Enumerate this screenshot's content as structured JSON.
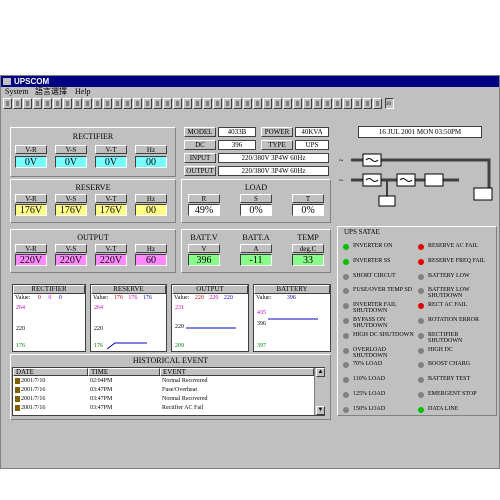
{
  "app": {
    "title": "UPSCOM"
  },
  "menu": [
    {
      "label": "System"
    },
    {
      "label": "語言選擇"
    },
    {
      "label": "Help"
    }
  ],
  "toolbar": {
    "count": 38,
    "selected_label": "30"
  },
  "rectifier": {
    "title": "RECTIFIER",
    "cols": [
      {
        "label": "V-R",
        "value": "0V"
      },
      {
        "label": "V-S",
        "value": "0V"
      },
      {
        "label": "V-T",
        "value": "0V"
      },
      {
        "label": "Hz",
        "value": "00"
      }
    ]
  },
  "reserve": {
    "title": "RESERVE",
    "cols": [
      {
        "label": "V-R",
        "value": "176V"
      },
      {
        "label": "V-S",
        "value": "176V"
      },
      {
        "label": "V-T",
        "value": "176V"
      },
      {
        "label": "Hz",
        "value": "00"
      }
    ]
  },
  "output": {
    "title": "OUTPUT",
    "cols": [
      {
        "label": "V-R",
        "value": "220V"
      },
      {
        "label": "V-S",
        "value": "220V"
      },
      {
        "label": "V-T",
        "value": "220V"
      },
      {
        "label": "Hz",
        "value": "60"
      }
    ]
  },
  "info": {
    "model_label": "MODEL",
    "model_value": "4033B",
    "power_label": "POWER",
    "power_value": "40KVA",
    "dc_label": "DC",
    "dc_value": "396",
    "type_label": "TYPE",
    "type_value": "UPS",
    "input_label": "INPUT",
    "input_value": "220/380V 3P4W 60Hz",
    "output_label": "OUTPUT",
    "output_value": "220/380V 3P4W 60Hz"
  },
  "load": {
    "title": "LOAD",
    "cols": [
      {
        "label": "R",
        "value": "49%"
      },
      {
        "label": "S",
        "value": "0%"
      },
      {
        "label": "T",
        "value": "0%"
      }
    ]
  },
  "battery_stats": {
    "cols": [
      {
        "title": "BATT.V",
        "label": "V",
        "value": "396"
      },
      {
        "title": "BATT.A",
        "label": "A",
        "value": "-11"
      },
      {
        "title": "TEMP",
        "label": "deg.C",
        "value": "33"
      }
    ]
  },
  "clock": {
    "text": "16 JUL 2001 MON  03:50PM"
  },
  "charts": [
    {
      "title": "RECTIFIER",
      "values_label": "Value:",
      "v1": "0",
      "v2": "0",
      "v3": "0",
      "labels": [
        "264",
        "220",
        "176"
      ]
    },
    {
      "title": "RESERVE",
      "values_label": "Value:",
      "v1": "176",
      "v2": "176",
      "v3": "176",
      "labels": [
        "264",
        "220",
        "176"
      ]
    },
    {
      "title": "OUTPUT",
      "values_label": "Value:",
      "v1": "220",
      "v2": "220",
      "v3": "220",
      "labels": [
        "231",
        "220",
        "209"
      ]
    },
    {
      "title": "BATTERY",
      "values_label": "Value:",
      "v1": "396",
      "v2": "",
      "v3": "",
      "labels": [
        "435",
        "396",
        "397"
      ]
    }
  ],
  "status": {
    "title": "UPS SATAE",
    "left": [
      {
        "label": "INVERTER ON",
        "color": "#00c000"
      },
      {
        "label": "INVERTER SS",
        "color": "#00c000"
      },
      {
        "label": "SHORT CIRCUT",
        "color": "#808080"
      },
      {
        "label": "FUSE/OVER TEMP SD",
        "color": "#808080"
      },
      {
        "label": "INVERTER FAIL SHUTDOWN",
        "color": "#808080"
      },
      {
        "label": "BYPASS ON SHUTDOWN",
        "color": "#808080"
      },
      {
        "label": "HIGH DC SHUTDOWN",
        "color": "#808080"
      },
      {
        "label": "OVERLOAD SHUTDOWN",
        "color": "#808080"
      },
      {
        "label": "70% LOAD",
        "color": "#808080"
      },
      {
        "label": "110% LOAD",
        "color": "#808080"
      },
      {
        "label": "125% LOAD",
        "color": "#808080"
      },
      {
        "label": "150% LOAD",
        "color": "#808080"
      }
    ],
    "right": [
      {
        "label": "RESERVE AC FAIL",
        "color": "#e00000"
      },
      {
        "label": "RESERVE FREQ FAIL",
        "color": "#e00000"
      },
      {
        "label": "BATTERY LOW",
        "color": "#808080"
      },
      {
        "label": "BATTERY LOW SHUTDOWN",
        "color": "#808080"
      },
      {
        "label": "RECT AC FAIL",
        "color": "#e00000"
      },
      {
        "label": "ROTATION ERROR",
        "color": "#808080"
      },
      {
        "label": "RECTIFIER SHUTDOWN",
        "color": "#808080"
      },
      {
        "label": "HIGH DC",
        "color": "#808080"
      },
      {
        "label": "BOOST CHARG",
        "color": "#808080"
      },
      {
        "label": "BATTERY TEST",
        "color": "#808080"
      },
      {
        "label": "EMERGENT STOP",
        "color": "#808080"
      },
      {
        "label": "DATA LINE",
        "color": "#00c000"
      }
    ]
  },
  "history": {
    "title": "HISTORICAL EVENT",
    "headers": [
      "DATE",
      "TIME",
      "EVENT"
    ],
    "rows": [
      {
        "date": "2001/7/10",
        "time": "02:04PM",
        "event": "Normal Recovered"
      },
      {
        "date": "2001/7/16",
        "time": "03:47PM",
        "event": "Fuse/Overheat"
      },
      {
        "date": "2001/7/16",
        "time": "03:47PM",
        "event": "Normal Recovered"
      },
      {
        "date": "2001/7/16",
        "time": "03:47PM",
        "event": "Rectifier AC Fail"
      }
    ]
  },
  "colors": {
    "titlebar": "#000080",
    "window": "#c0c0c0"
  }
}
